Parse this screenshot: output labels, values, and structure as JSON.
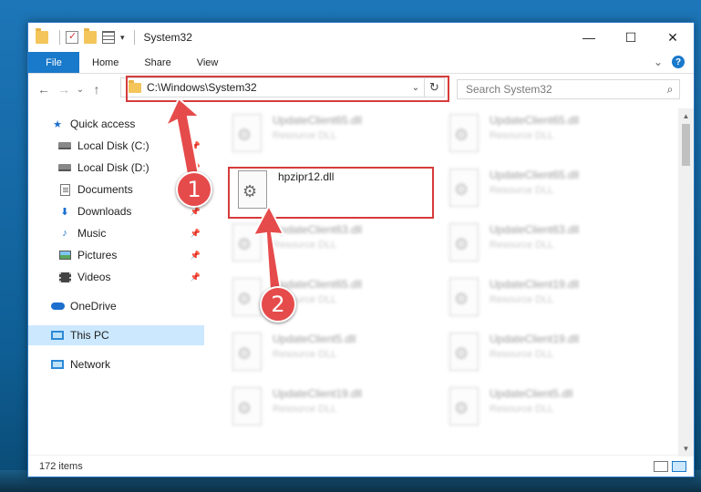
{
  "window": {
    "title": "System32",
    "controls": {
      "minimize": "—",
      "maximize": "☐",
      "close": "✕"
    }
  },
  "ribbon": {
    "tabs": [
      "File",
      "Home",
      "Share",
      "View"
    ],
    "expand": "⌄",
    "help": "?"
  },
  "nav": {
    "back": "←",
    "forward": "→",
    "recent": "⌄",
    "up": "↑"
  },
  "address": {
    "path": "C:\\Windows\\System32",
    "dropdown": "⌄",
    "refresh": "↻"
  },
  "search": {
    "placeholder": "Search System32",
    "icon": "⌕"
  },
  "sidebar": {
    "items": [
      {
        "label": "Quick access",
        "icon": "star-icon"
      },
      {
        "label": "Local Disk (C:)",
        "icon": "drive-icon",
        "pinned": true
      },
      {
        "label": "Local Disk (D:)",
        "icon": "drive-icon",
        "pinned": true
      },
      {
        "label": "Documents",
        "icon": "documents-icon",
        "pinned": true
      },
      {
        "label": "Downloads",
        "icon": "downloads-icon",
        "pinned": true
      },
      {
        "label": "Music",
        "icon": "music-icon",
        "pinned": true
      },
      {
        "label": "Pictures",
        "icon": "pictures-icon",
        "pinned": true
      },
      {
        "label": "Videos",
        "icon": "videos-icon",
        "pinned": true
      },
      {
        "label": "OneDrive",
        "icon": "cloud-icon"
      },
      {
        "label": "This PC",
        "icon": "computer-icon",
        "selected": true
      },
      {
        "label": "Network",
        "icon": "network-icon"
      }
    ],
    "pin_glyph": "📌"
  },
  "files": {
    "left": [
      {
        "name": "UpdateClient65.dll",
        "desc": "Resource DLL"
      },
      {
        "name": "hpzipr12.dll",
        "desc": ""
      },
      {
        "name": "UpdateClient63.dll",
        "desc": "Resource DLL"
      },
      {
        "name": "UpdateClient65.dll",
        "desc": "Resource DLL"
      },
      {
        "name": "UpdateClient5.dll",
        "desc": "Resource DLL"
      },
      {
        "name": "UpdateClient19.dll",
        "desc": "Resource DLL"
      }
    ],
    "right": [
      {
        "name": "UpdateClient65.dll",
        "desc": "Resource DLL"
      },
      {
        "name": "UpdateClient65.dll",
        "desc": "Resource DLL"
      },
      {
        "name": "UpdateClient63.dll",
        "desc": "Resource DLL"
      },
      {
        "name": "UpdateClient19.dll",
        "desc": "Resource DLL"
      },
      {
        "name": "UpdateClient19.dll",
        "desc": "Resource DLL"
      },
      {
        "name": "UpdateClient5.dll",
        "desc": "Resource DLL"
      }
    ]
  },
  "status": {
    "count": "172 items"
  },
  "markers": {
    "one": "1",
    "two": "2"
  },
  "colors": {
    "accent": "#1979ca",
    "highlight": "#d63b3b",
    "marker": "#e64b4b"
  }
}
